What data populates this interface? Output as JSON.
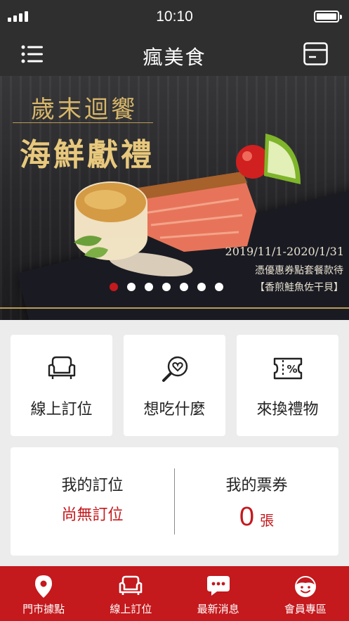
{
  "status_bar": {
    "time": "10:10"
  },
  "header": {
    "brand": "瘋美食"
  },
  "banner": {
    "title_line1": "歲末迴饗",
    "title_line2": "海鮮獻禮",
    "date_range": "2019/11/1-2020/1/31",
    "note": "憑優惠券點套餐款待",
    "dish": "【香煎鮭魚佐干貝】",
    "carousel": {
      "total": 7,
      "active_index": 1
    }
  },
  "quick_actions": [
    {
      "label": "線上訂位",
      "icon": "sofa-icon"
    },
    {
      "label": "想吃什麼",
      "icon": "search-heart-icon"
    },
    {
      "label": "來換禮物",
      "icon": "coupon-icon"
    }
  ],
  "my_panel": {
    "reservation_title": "我的訂位",
    "reservation_value": "尚無訂位",
    "tickets_title": "我的票券",
    "tickets_count": "0",
    "tickets_unit": "張"
  },
  "tabbar": [
    {
      "label": "門市據點",
      "icon": "location-pin-icon"
    },
    {
      "label": "線上訂位",
      "icon": "sofa-icon"
    },
    {
      "label": "最新消息",
      "icon": "chat-bubble-icon"
    },
    {
      "label": "會員專區",
      "icon": "member-face-icon"
    }
  ],
  "colors": {
    "accent": "#c4191d",
    "header": "#2f2f2f",
    "gold": "#d8b76a",
    "background": "#ececec"
  }
}
